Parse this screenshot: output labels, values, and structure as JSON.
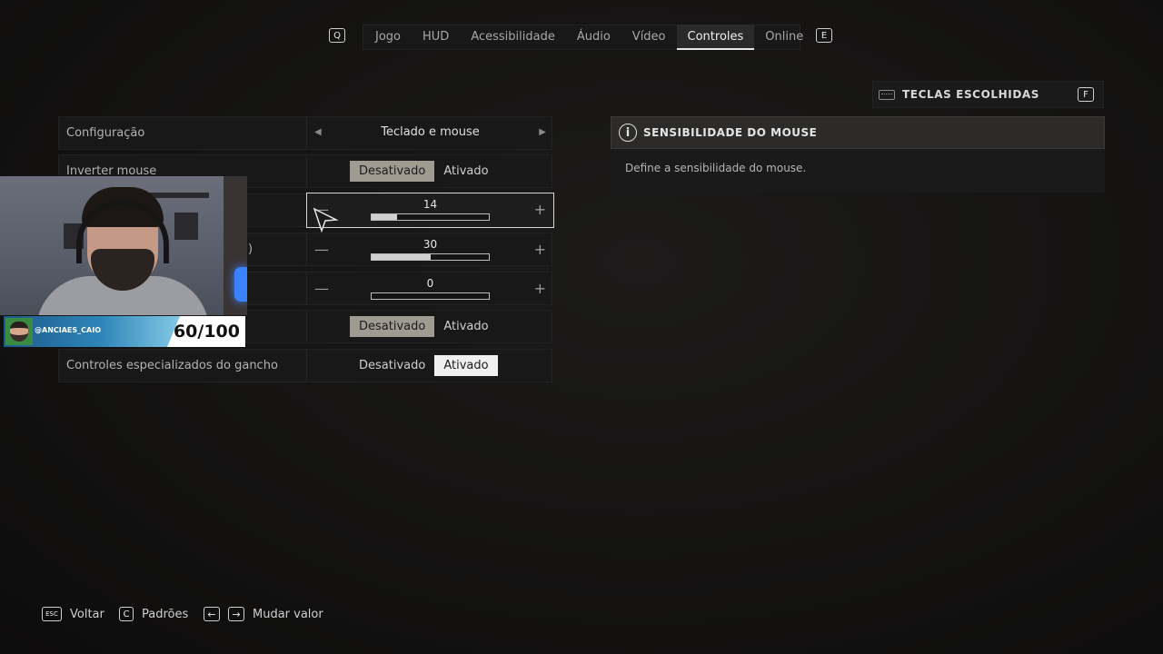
{
  "tabs": {
    "prev_key": "Q",
    "next_key": "E",
    "items": [
      {
        "label": "Jogo",
        "active": false
      },
      {
        "label": "HUD",
        "active": false
      },
      {
        "label": "Acessibilidade",
        "active": false
      },
      {
        "label": "Áudio",
        "active": false
      },
      {
        "label": "Vídeo",
        "active": false
      },
      {
        "label": "Controles",
        "active": true
      },
      {
        "label": "Online",
        "active": false
      }
    ]
  },
  "chosen_keys": {
    "label": "TECLAS ESCOLHIDAS",
    "key": "F",
    "icon": "keyboard-icon"
  },
  "info": {
    "icon": "info-icon",
    "icon_glyph": "i",
    "title": "SENSIBILIDADE DO MOUSE",
    "description": "Define a sensibilidade do mouse."
  },
  "settings": {
    "config": {
      "label": "Configuração",
      "value": "Teclado e mouse"
    },
    "invert_mouse": {
      "label": "Inverter mouse",
      "off": "Desativado",
      "on": "Ativado",
      "selected": "Desativado"
    },
    "sensitivity": {
      "value": "14",
      "fraction": 0.22
    },
    "slider2": {
      "label_fragment": ")",
      "value": "30",
      "fraction": 0.5
    },
    "slider3": {
      "value": "0",
      "fraction": 0
    },
    "toggle5": {
      "off": "Desativado",
      "on": "Ativado",
      "selected": "Desativado"
    },
    "grapple": {
      "label": "Controles especializados do gancho",
      "off": "Desativado",
      "on": "Ativado",
      "selected": "Ativado"
    }
  },
  "stream_overlay": {
    "handle": "@ANCIAES_CAIO",
    "score": "60/100"
  },
  "footer": {
    "back_key": "ESC",
    "back_label": "Voltar",
    "defaults_key": "C",
    "defaults_label": "Padrões",
    "left_key": "←",
    "right_key": "→",
    "change_label": "Mudar valor"
  },
  "colors": {
    "background": "#141312",
    "toggle_selected": "#9f9b90",
    "toggle_selected_white": "#efefef",
    "accent_light": "#3a82ff"
  }
}
